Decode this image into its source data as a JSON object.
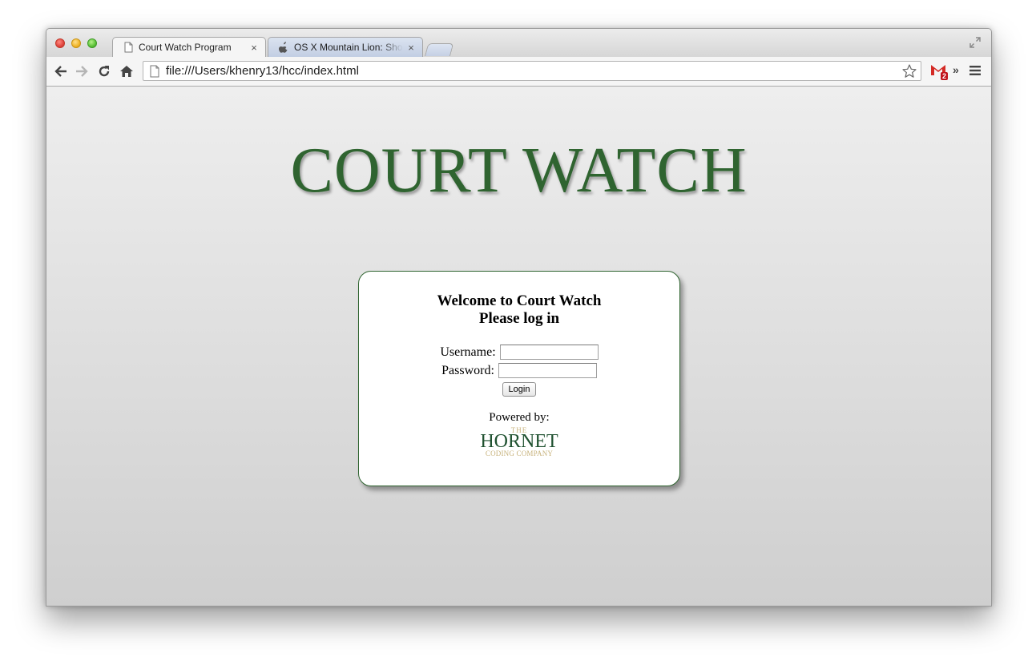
{
  "browser": {
    "tabs": [
      {
        "title": "Court Watch Program",
        "close": "×",
        "active": true
      },
      {
        "title": "OS X Mountain Lion: Shortcuts",
        "close": "×",
        "active": false
      }
    ],
    "address_bar": {
      "url": "file:///Users/khenry13/hcc/index.html"
    },
    "gmail_badge": "2",
    "overflow_chevron": "»",
    "icons": [
      "back-arrow-icon",
      "forward-arrow-icon",
      "reload-icon",
      "home-icon",
      "page-icon",
      "star-icon",
      "gmail-icon",
      "menu-icon",
      "fullscreen-icon"
    ]
  },
  "page": {
    "title": "COURT WATCH",
    "card": {
      "welcome_line1": "Welcome to Court Watch",
      "welcome_line2": "Please log in",
      "username_label": "Username:",
      "password_label": "Password:",
      "username_value": "",
      "password_value": "",
      "login_button": "Login",
      "powered_by": "Powered by:",
      "logo": {
        "the": "THE",
        "name": "HORNET",
        "subtitle": "CODING COMPANY"
      }
    }
  },
  "colors": {
    "title_green": "#2f6430",
    "logo_green": "#1f5130",
    "logo_gold": "#c7b27b"
  }
}
